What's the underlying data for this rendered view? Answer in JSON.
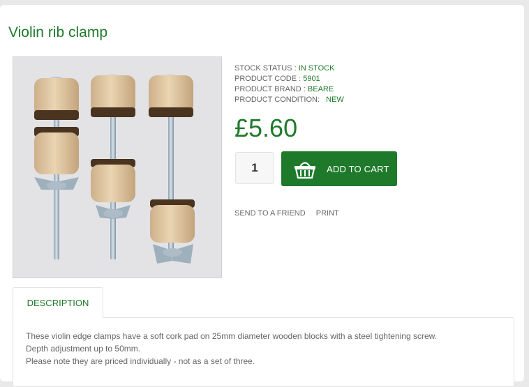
{
  "product": {
    "title": "Violin rib clamp",
    "stock_label": "STOCK STATUS : ",
    "stock_value": "IN STOCK",
    "code_label": "PRODUCT CODE : ",
    "code_value": "5901",
    "brand_label": "PRODUCT BRAND : ",
    "brand_value": "BEARE",
    "condition_label": "PRODUCT CONDITION: ",
    "condition_value": "NEW",
    "price": "£5.60",
    "quantity": "1",
    "add_to_cart": "ADD TO CART"
  },
  "links": {
    "send_to_friend": "SEND TO A FRIEND",
    "print": "PRINT"
  },
  "tabs": {
    "description": "DESCRIPTION"
  },
  "description": {
    "line1": "These violin edge clamps have a soft cork pad on 25mm diameter wooden blocks with a steel tightening screw.",
    "line2": "Depth adjustment up to 50mm.",
    "line3": "Please note they are priced individually - not as a set of three."
  },
  "colors": {
    "accent": "#1f7a2b",
    "button": "#1e7a2a"
  },
  "icons": {
    "cart": "basket-icon"
  }
}
